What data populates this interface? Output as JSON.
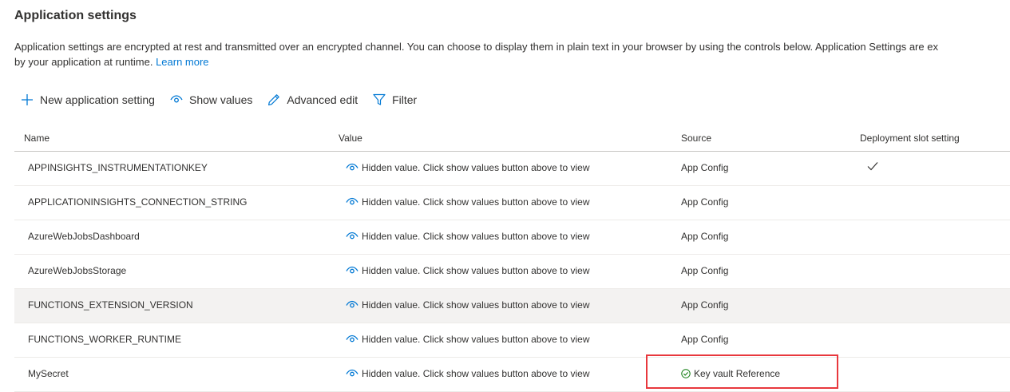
{
  "page": {
    "title": "Application settings",
    "description_line1": "Application settings are encrypted at rest and transmitted over an encrypted channel. You can choose to display them in plain text in your browser by using the controls below. Application Settings are ex",
    "description_line2": "by your application at runtime.",
    "learn_more": "Learn more"
  },
  "toolbar": {
    "new_setting": "New application setting",
    "show_values": "Show values",
    "advanced_edit": "Advanced edit",
    "filter": "Filter"
  },
  "table": {
    "headers": {
      "name": "Name",
      "value": "Value",
      "source": "Source",
      "slot": "Deployment slot setting"
    },
    "rows": [
      {
        "name": "APPINSIGHTS_INSTRUMENTATIONKEY",
        "value": "Hidden value. Click show values button above to view",
        "source": "App Config",
        "slot_checked": true
      },
      {
        "name": "APPLICATIONINSIGHTS_CONNECTION_STRING",
        "value": "Hidden value. Click show values button above to view",
        "source": "App Config",
        "slot_checked": false
      },
      {
        "name": "AzureWebJobsDashboard",
        "value": "Hidden value. Click show values button above to view",
        "source": "App Config",
        "slot_checked": false
      },
      {
        "name": "AzureWebJobsStorage",
        "value": "Hidden value. Click show values button above to view",
        "source": "App Config",
        "slot_checked": false
      },
      {
        "name": "FUNCTIONS_EXTENSION_VERSION",
        "value": "Hidden value. Click show values button above to view",
        "source": "App Config",
        "slot_checked": false
      },
      {
        "name": "FUNCTIONS_WORKER_RUNTIME",
        "value": "Hidden value. Click show values button above to view",
        "source": "App Config",
        "slot_checked": false
      },
      {
        "name": "MySecret",
        "value": "Hidden value. Click show values button above to view",
        "source": "Key vault Reference",
        "slot_checked": false
      }
    ]
  },
  "colors": {
    "accent": "#0078d4",
    "highlight": "#e8383d",
    "success": "#107c10",
    "row_hover": "#f3f2f1"
  },
  "icons": {
    "new": "plus-icon",
    "show": "eye-icon",
    "edit": "pencil-icon",
    "filter": "filter-icon",
    "check": "checkmark-icon",
    "kv": "check-circle-icon"
  }
}
